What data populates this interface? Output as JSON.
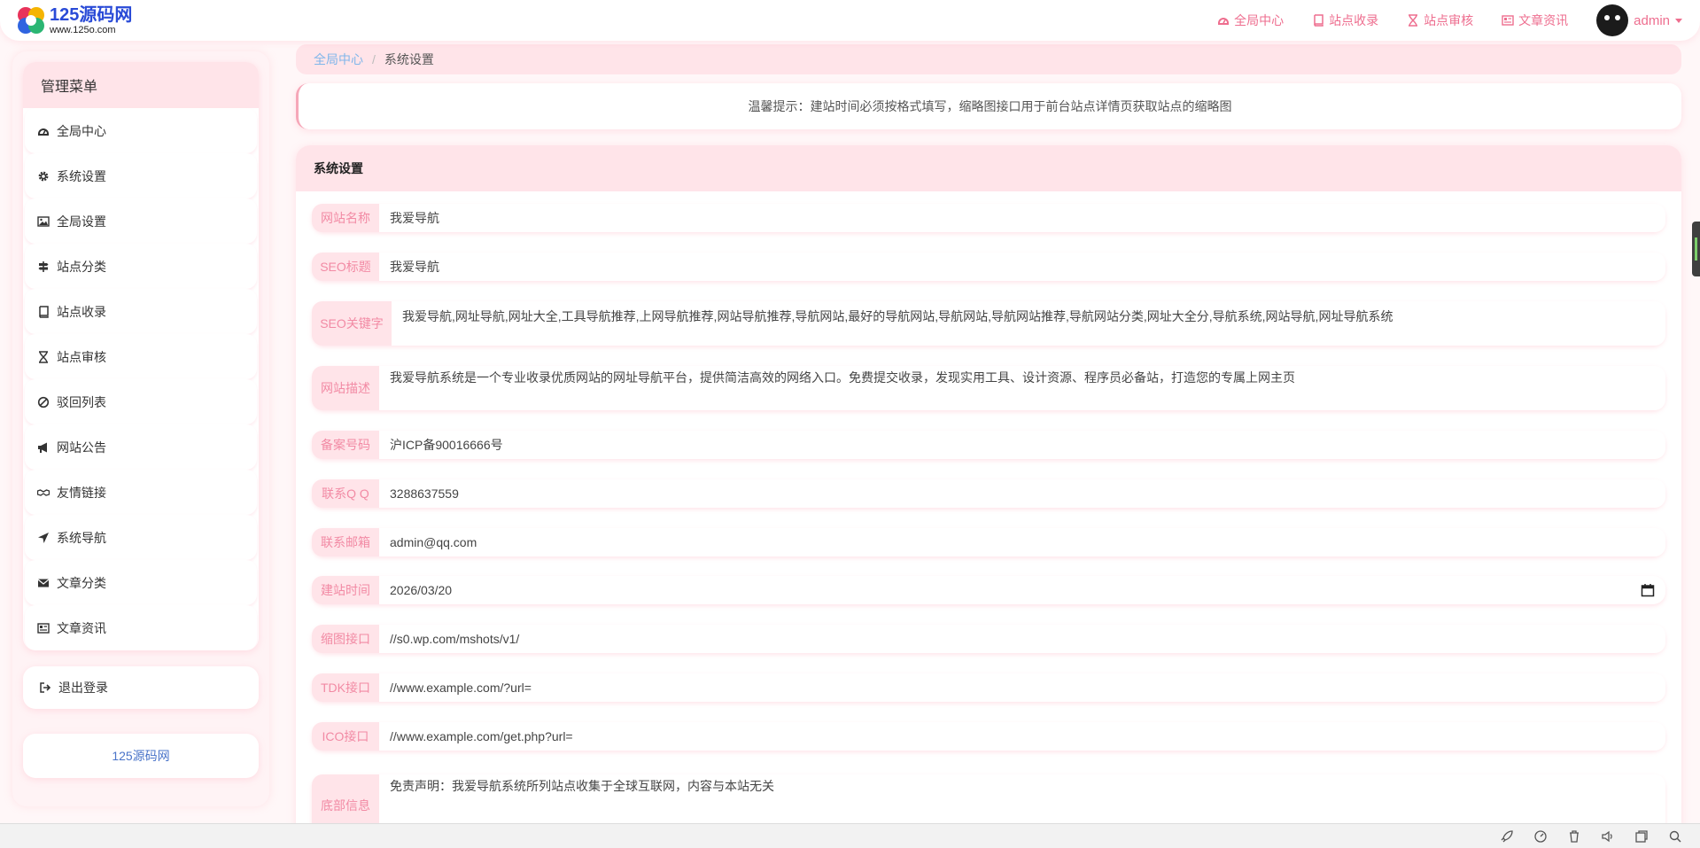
{
  "header": {
    "logo_title": "125源码网",
    "logo_sub": "www.125o.com",
    "nav": [
      {
        "label": "全局中心",
        "icon": "dashboard-icon"
      },
      {
        "label": "站点收录",
        "icon": "book-icon"
      },
      {
        "label": "站点审核",
        "icon": "hourglass-icon"
      },
      {
        "label": "文章资讯",
        "icon": "newspaper-icon"
      }
    ],
    "user": "admin"
  },
  "sidebar": {
    "title": "管理菜单",
    "items": [
      {
        "label": "全局中心",
        "icon": "dashboard-icon"
      },
      {
        "label": "系统设置",
        "icon": "gear-icon"
      },
      {
        "label": "全局设置",
        "icon": "image-icon"
      },
      {
        "label": "站点分类",
        "icon": "signpost-icon"
      },
      {
        "label": "站点收录",
        "icon": "book-icon"
      },
      {
        "label": "站点审核",
        "icon": "hourglass-icon"
      },
      {
        "label": "驳回列表",
        "icon": "ban-icon"
      },
      {
        "label": "网站公告",
        "icon": "megaphone-icon"
      },
      {
        "label": "友情链接",
        "icon": "handshake-icon"
      },
      {
        "label": "系统导航",
        "icon": "location-arrow-icon"
      },
      {
        "label": "文章分类",
        "icon": "envelope-icon"
      },
      {
        "label": "文章资讯",
        "icon": "newspaper-icon"
      }
    ],
    "logout": "退出登录",
    "brand": "125源码网"
  },
  "breadcrumb": {
    "home": "全局中心",
    "separator": "/",
    "current": "系统设置"
  },
  "notice": "温馨提示：建站时间必须按格式填写，缩略图接口用于前台站点详情页获取站点的缩略图",
  "panel": {
    "title": "系统设置",
    "fields": {
      "site_name": {
        "label": "网站名称",
        "value": "我爱导航"
      },
      "seo_title": {
        "label": "SEO标题",
        "value": "我爱导航"
      },
      "seo_keywords": {
        "label": "SEO关键字",
        "value": "我爱导航,网址导航,网址大全,工具导航推荐,上网导航推荐,网站导航推荐,导航网站,最好的导航网站,导航网站,导航网站推荐,导航网站分类,网址大全分,导航系统,网站导航,网址导航系统"
      },
      "site_desc": {
        "label": "网站描述",
        "value": "我爱导航系统是一个专业收录优质网站的网址导航平台，提供简洁高效的网络入口。免费提交收录，发现实用工具、设计资源、程序员必备站，打造您的专属上网主页"
      },
      "icp": {
        "label": "备案号码",
        "value": "沪ICP备90016666号"
      },
      "qq": {
        "label": "联系Q Q",
        "value": "3288637559"
      },
      "email": {
        "label": "联系邮箱",
        "value": "admin@qq.com"
      },
      "build_date": {
        "label": "建站时间",
        "value": "2026/03/20"
      },
      "thumb_api": {
        "label": "缩图接口",
        "value": "//s0.wp.com/mshots/v1/"
      },
      "tdk_api": {
        "label": "TDK接口",
        "value": "//www.example.com/?url="
      },
      "ico_api": {
        "label": "ICO接口",
        "value": "//www.example.com/get.php?url="
      },
      "footer": {
        "label": "底部信息",
        "value": "免责声明：我爱导航系统所列站点收集于全球互联网，内容与本站无关"
      }
    }
  },
  "colors": {
    "accent": "#ee6e8f",
    "label_bg": "#ffe4e9",
    "label_text": "#f28aa4",
    "link": "#7fb6ea"
  }
}
